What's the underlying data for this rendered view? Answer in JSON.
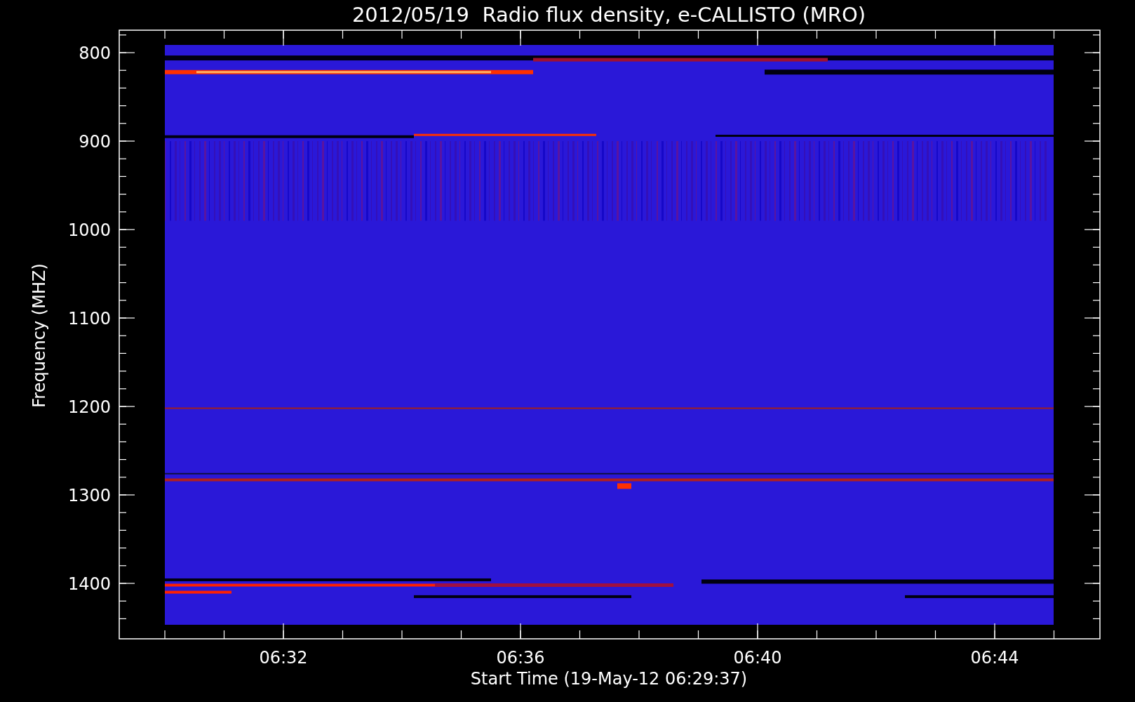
{
  "title": "2012/05/19  Radio flux density, e-CALLISTO (MRO)",
  "y_axis": {
    "label": "Frequency (MHZ)",
    "ticks": [
      "800",
      "900",
      "1000",
      "1100",
      "1200",
      "1300",
      "1400"
    ]
  },
  "x_axis": {
    "label": "Start Time (19-May-12 06:29:37)",
    "ticks": [
      "06:32",
      "06:36",
      "06:40",
      "06:44"
    ]
  }
}
